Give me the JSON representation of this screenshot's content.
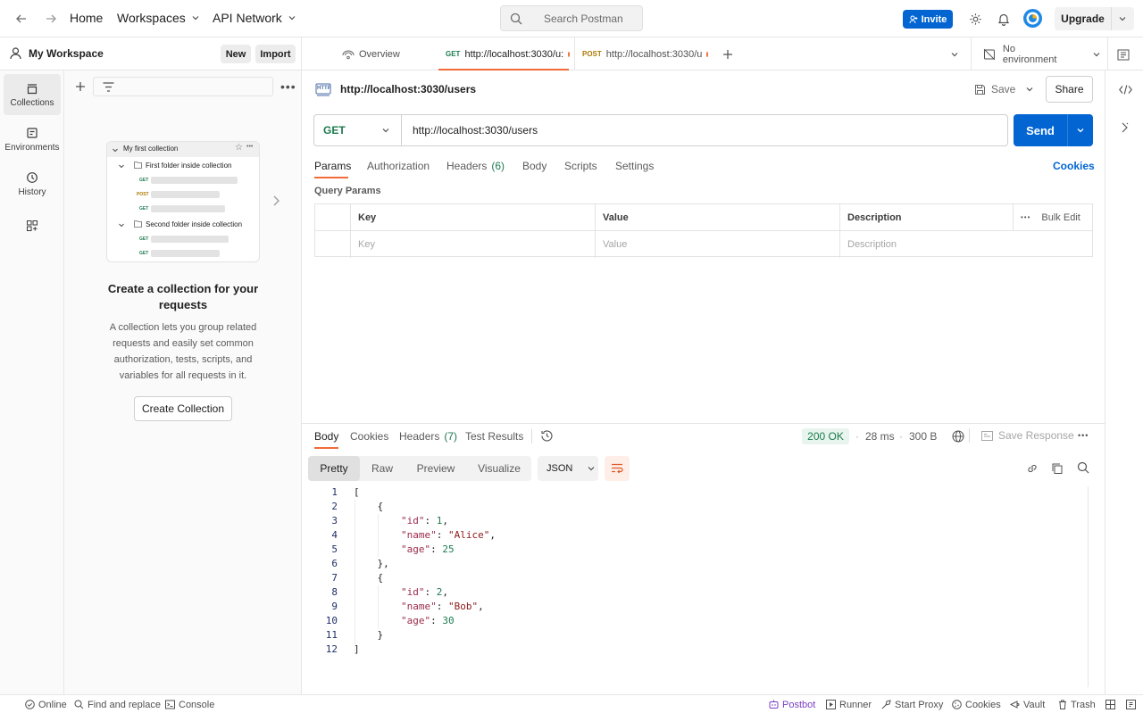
{
  "topbar": {
    "home": "Home",
    "workspaces": "Workspaces",
    "api_network": "API Network",
    "search_placeholder": "Search Postman",
    "invite": "Invite",
    "upgrade": "Upgrade"
  },
  "sidebar": {
    "workspace_name": "My Workspace",
    "new_label": "New",
    "import_label": "Import",
    "rail": [
      {
        "label": "Collections",
        "icon": "collections-icon"
      },
      {
        "label": "Environments",
        "icon": "environments-icon"
      },
      {
        "label": "History",
        "icon": "history-icon"
      }
    ],
    "preview": {
      "collection": "My first collection",
      "folder1": "First folder inside collection",
      "folder2": "Second folder inside collection",
      "m_get": "GET",
      "m_post": "POST"
    },
    "empty_title": "Create a collection for your requests",
    "empty_desc": "A collection lets you group related requests and easily set common authorization, tests, scripts, and variables for all requests in it.",
    "create_button": "Create Collection"
  },
  "tabs": {
    "overview": "Overview",
    "tab1_method": "GET",
    "tab1_url": "http://localhost:3030/u:",
    "tab2_method": "POST",
    "tab2_url": "http://localhost:3030/u",
    "environment": "No environment"
  },
  "request": {
    "http_badge": "HTTP",
    "title": "http://localhost:3030/users",
    "save": "Save",
    "share": "Share",
    "method": "GET",
    "url": "http://localhost:3030/users",
    "send": "Send",
    "tabs": {
      "params": "Params",
      "authorization": "Authorization",
      "headers": "Headers",
      "headers_count": "(6)",
      "body": "Body",
      "scripts": "Scripts",
      "settings": "Settings",
      "cookies": "Cookies"
    },
    "query_params": "Query Params",
    "table": {
      "key": "Key",
      "value": "Value",
      "description": "Description",
      "bulk_edit": "Bulk Edit",
      "key_ph": "Key",
      "value_ph": "Value",
      "description_ph": "Description"
    }
  },
  "response": {
    "tabs": {
      "body": "Body",
      "cookies": "Cookies",
      "headers": "Headers",
      "headers_count": "(7)",
      "test_results": "Test Results"
    },
    "status": "200 OK",
    "time": "28 ms",
    "size": "300 B",
    "save_response": "Save Response",
    "views": {
      "pretty": "Pretty",
      "raw": "Raw",
      "preview": "Preview",
      "visualize": "Visualize"
    },
    "format": "JSON",
    "lines": [
      {
        "n": "1",
        "t": "["
      },
      {
        "n": "2",
        "t": "    {"
      },
      {
        "n": "3",
        "k": "\"id\"",
        "v": "1",
        "vt": "n",
        "comma": ","
      },
      {
        "n": "4",
        "k": "\"name\"",
        "v": "\"Alice\"",
        "vt": "s",
        "comma": ","
      },
      {
        "n": "5",
        "k": "\"age\"",
        "v": "25",
        "vt": "n",
        "comma": ""
      },
      {
        "n": "6",
        "t": "    },"
      },
      {
        "n": "7",
        "t": "    {"
      },
      {
        "n": "8",
        "k": "\"id\"",
        "v": "2",
        "vt": "n",
        "comma": ","
      },
      {
        "n": "9",
        "k": "\"name\"",
        "v": "\"Bob\"",
        "vt": "s",
        "comma": ","
      },
      {
        "n": "10",
        "k": "\"age\"",
        "v": "30",
        "vt": "n",
        "comma": ""
      },
      {
        "n": "11",
        "t": "    }"
      },
      {
        "n": "12",
        "t": "]"
      }
    ]
  },
  "statusbar": {
    "online": "Online",
    "find_replace": "Find and replace",
    "console": "Console",
    "postbot": "Postbot",
    "runner": "Runner",
    "start_proxy": "Start Proxy",
    "cookies": "Cookies",
    "vault": "Vault",
    "trash": "Trash"
  },
  "colors": {
    "accent": "#0265d2",
    "tab_underline": "#f26b3a",
    "status_ok": "#1c7a4e",
    "get_method": "#1c7a4e",
    "post_method": "#ad7a03"
  }
}
